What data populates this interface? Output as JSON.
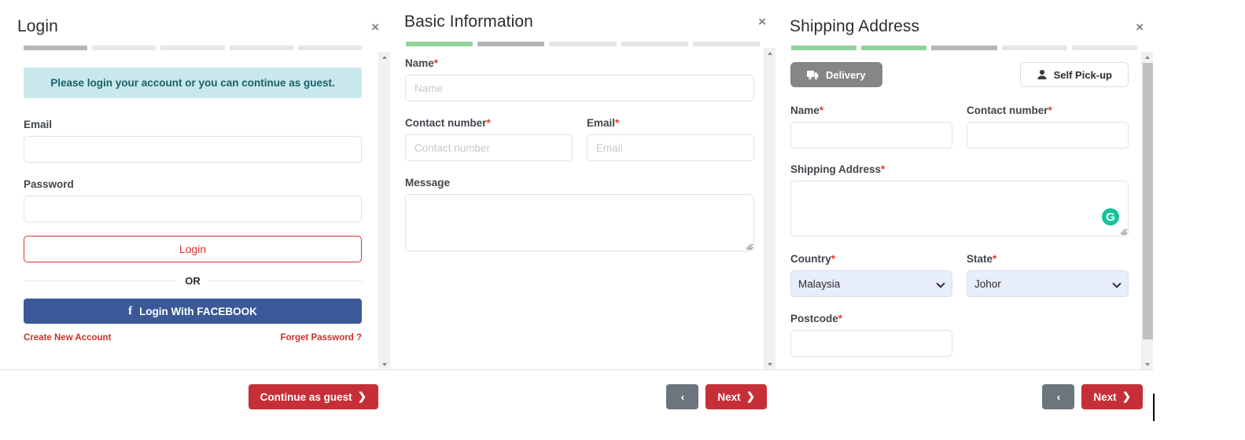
{
  "panels": {
    "login": {
      "title": "Login",
      "close_label": "×",
      "progress": {
        "total": 5,
        "states": [
          "active",
          "todo",
          "todo",
          "todo",
          "todo"
        ]
      },
      "alert": "Please login your account or you can continue as guest.",
      "email_label": "Email",
      "email_value": "",
      "password_label": "Password",
      "password_value": "",
      "login_button": "Login",
      "or_text": "OR",
      "facebook_button": "Login With FACEBOOK",
      "facebook_glyph": "f",
      "create_account_link": "Create New Account",
      "forget_password_link": "Forget Password ?",
      "footer_button": "Continue as guest",
      "footer_button_chevron": "❯"
    },
    "basic_information": {
      "title": "Basic Information",
      "close_label": "×",
      "progress": {
        "total": 5,
        "states": [
          "done",
          "active",
          "todo",
          "todo",
          "todo"
        ]
      },
      "name_label": "Name",
      "name_placeholder": "Name",
      "name_value": "",
      "contact_label": "Contact number",
      "contact_placeholder": "Contact number",
      "contact_value": "",
      "email_label": "Email",
      "email_placeholder": "Email",
      "email_value": "",
      "message_label": "Message",
      "message_value": "",
      "back_button": "‹",
      "next_button": "Next",
      "next_button_chevron": "❯"
    },
    "shipping_address": {
      "title": "Shipping Address",
      "close_label": "×",
      "progress": {
        "total": 5,
        "states": [
          "done",
          "done",
          "active",
          "todo",
          "todo"
        ]
      },
      "delivery_button": "Delivery",
      "self_pickup_button": "Self Pick-up",
      "name_label": "Name",
      "name_value": "",
      "contact_label": "Contact number",
      "contact_value": "",
      "address_label": "Shipping Address",
      "address_value": "",
      "grammarly_glyph": "G",
      "country_label": "Country",
      "country_value": "Malaysia",
      "country_options": [
        "Malaysia"
      ],
      "state_label": "State",
      "state_value": "Johor",
      "state_options": [
        "Johor"
      ],
      "postcode_label": "Postcode",
      "postcode_value": "",
      "back_button": "‹",
      "next_button": "Next",
      "next_button_chevron": "❯"
    }
  },
  "required_marker": "*",
  "colors": {
    "primary_red": "#c62f37",
    "login_red": "#d9302c",
    "facebook_blue": "#3b5998",
    "alert_teal": "#c8e8ec",
    "progress_done": "#8fd39a",
    "progress_active": "#b6b6b6",
    "progress_todo": "#e6e6e6",
    "toggle_active_gray": "#868686",
    "select_bg": "#e8edfa",
    "grammarly_green": "#15c39a",
    "back_gray": "#6c757d"
  }
}
